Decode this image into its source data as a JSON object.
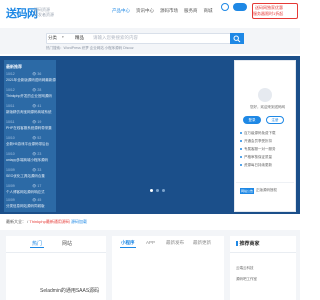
{
  "header": {
    "logo": "送码网",
    "logo_sub_1": "源码资源",
    "logo_sub_2": "开发者资源",
    "nav": [
      "产品中心",
      "资讯中心",
      "源码市场",
      "服务商",
      "商城"
    ],
    "promo_line_1": "送码网独家优惠",
    "promo_line_2": "服务器限时1折起"
  },
  "search": {
    "type": "分类",
    "engine": "精品",
    "placeholder": "请输入您要搜索的内容",
    "hot": "热门搜索：WordPress  织梦  企业网站  小程序源码  Discuz"
  },
  "latest": {
    "title": "最新推荐",
    "items": [
      {
        "date": "10/12",
        "views": "👁 36",
        "text": "2021年全新版源码送码网最新源码"
      },
      {
        "date": "10/12",
        "views": "👁 28",
        "text": "Thinkphp开发的企业官网源码"
      },
      {
        "date": "10/11",
        "views": "👁 41",
        "text": "新版精仿淘宝网源码商城系统"
      },
      {
        "date": "10/11",
        "views": "👁 19",
        "text": "PHP在线客服系统源码带采集"
      },
      {
        "date": "10/10",
        "views": "👁 52",
        "text": "全新H5游戏平台源码带后台"
      },
      {
        "date": "10/10",
        "views": "👁 23",
        "text": "uniapp多端商城小程序源码"
      },
      {
        "date": "10/09",
        "views": "👁 33",
        "text": "SEO优化工具站源码合集"
      },
      {
        "date": "10/09",
        "views": "👁 17",
        "text": "个人博客网站源码响应式"
      },
      {
        "date": "10/09",
        "views": "👁 45",
        "text": "分类信息网站源码同城版"
      }
    ]
  },
  "user_panel": {
    "hello": "您好，欢迎来到送码网",
    "login": "登录",
    "register": "注册",
    "benefits": [
      "百万级源码免费下载",
      "开通会员享受折扣",
      "专属客服一对一服务",
      "严格审核保证质量",
      "资源每日持续更新"
    ],
    "notice_badge": "网站公告",
    "notice_text": "正版源码授权"
  },
  "breadcrumb": {
    "label": "最新大全：",
    "sep": "/",
    "link": "Thinkphp最新通用源码",
    "extra": "源码加载"
  },
  "left_card": {
    "tabs": [
      "热门",
      "网站"
    ],
    "item": "Seladmin的通用SAAS源码"
  },
  "mid_card": {
    "tabs": [
      "小程序",
      "APP",
      "最新发布",
      "最新更新"
    ]
  },
  "right_card": {
    "title": "推荐商家",
    "items": [
      "云端云科技",
      "源码吧工作室"
    ]
  }
}
